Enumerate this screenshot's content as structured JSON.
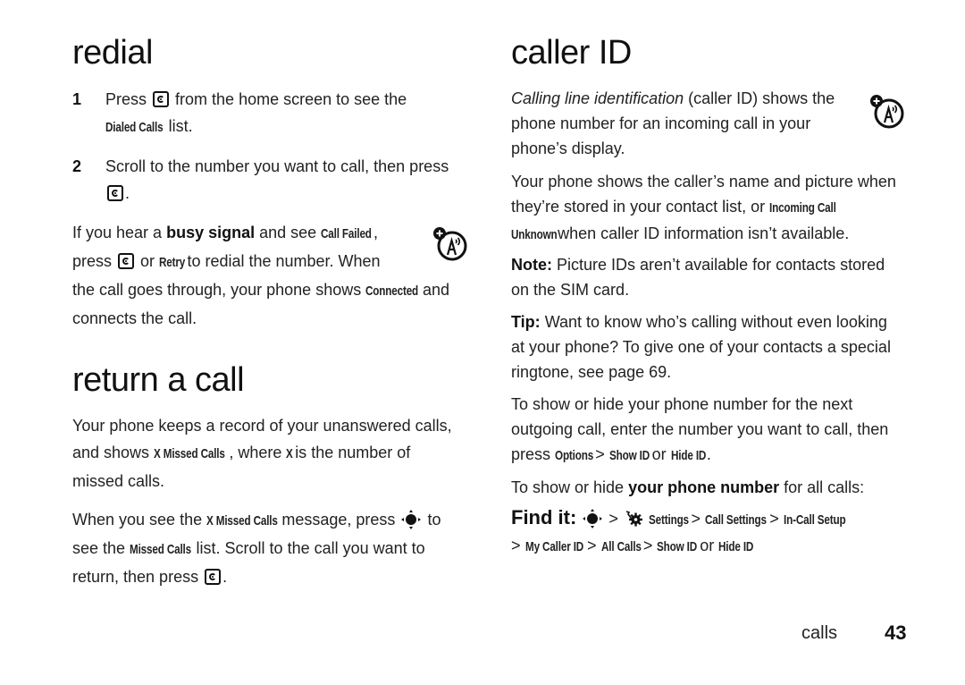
{
  "left_column": {
    "redial": {
      "heading": "redial",
      "steps": [
        {
          "num": "1",
          "text_a": "Press",
          "text_b": "from the home screen to see the",
          "ui_label": "Dialed Calls",
          "text_c": "list."
        },
        {
          "num": "2",
          "text_a": "Scroll to the number you want to call, then press",
          "text_b": "."
        }
      ],
      "busy": {
        "text_a": "If you hear a",
        "bold": "busy signal",
        "text_b": "and see",
        "ui_call_failed": "Call Failed",
        "text_c": ",",
        "text_d": "press",
        "text_e": "or",
        "ui_retry": "Retry",
        "text_f": "to redial the number. When",
        "text_g": "the call goes through, your phone shows",
        "ui_connected": "Connected",
        "text_h": "and",
        "text_i": "connects the call."
      }
    },
    "return_call": {
      "heading": "return a call",
      "para1": {
        "text_a": "Your phone keeps a record of your unanswered calls,",
        "text_b": "and shows",
        "ui_missed": "X Missed Calls",
        "text_c": ", where",
        "ui_x": "X",
        "text_d": "is the number of",
        "text_e": "missed calls."
      },
      "para2": {
        "text_a": "When you see the",
        "ui_missed": "X Missed Calls",
        "text_b": "message, press",
        "text_c": "to",
        "text_d": "see the",
        "ui_missed_list": "Missed Calls",
        "text_e": "list. Scroll to the call you want to",
        "text_f": "return, then press",
        "text_g": "."
      }
    }
  },
  "right_column": {
    "caller_id": {
      "heading": "caller ID",
      "intro": {
        "italic": "Calling line identification",
        "text_a": "(caller ID) shows the",
        "text_b": "phone number for an incoming call in your",
        "text_c": "phone’s display."
      },
      "para_shows": {
        "text_a": "Your phone shows the caller’s name and picture when",
        "text_b": "they’re stored in your contact list, or",
        "ui_incoming": "Incoming Call",
        "ui_unknown": "Unknown",
        "text_c": "when caller ID information isn’t available."
      },
      "note": {
        "label": "Note:",
        "text_a": "Picture IDs aren’t available for contacts stored",
        "text_b": "on the SIM card."
      },
      "tip": {
        "label": "Tip:",
        "text_a": "Want to know who’s calling without even looking",
        "text_b": "at your phone? To give one of your contacts a special",
        "text_c": "ringtone, see page 69."
      },
      "next_call": {
        "text_a": "To show or hide your phone number for the next",
        "text_b": "outgoing call, enter the number you want to call, then",
        "text_c": "press",
        "ui_options": "Options",
        "sep": ">",
        "ui_show": "Show ID",
        "text_or": "or",
        "ui_hide": "Hide ID",
        "text_end": "."
      },
      "all_calls": {
        "text_a": "To show or hide",
        "bold": "your phone number",
        "text_b": "for all calls:"
      },
      "find_it": {
        "label": "Find it:",
        "sep": ">",
        "path": [
          "Settings",
          "Call Settings",
          "In-Call Setup",
          "My Caller ID",
          "All Calls",
          "Show ID"
        ],
        "or_text": "or",
        "alt": "Hide ID"
      }
    }
  },
  "footer": {
    "section": "calls",
    "page": "43"
  }
}
